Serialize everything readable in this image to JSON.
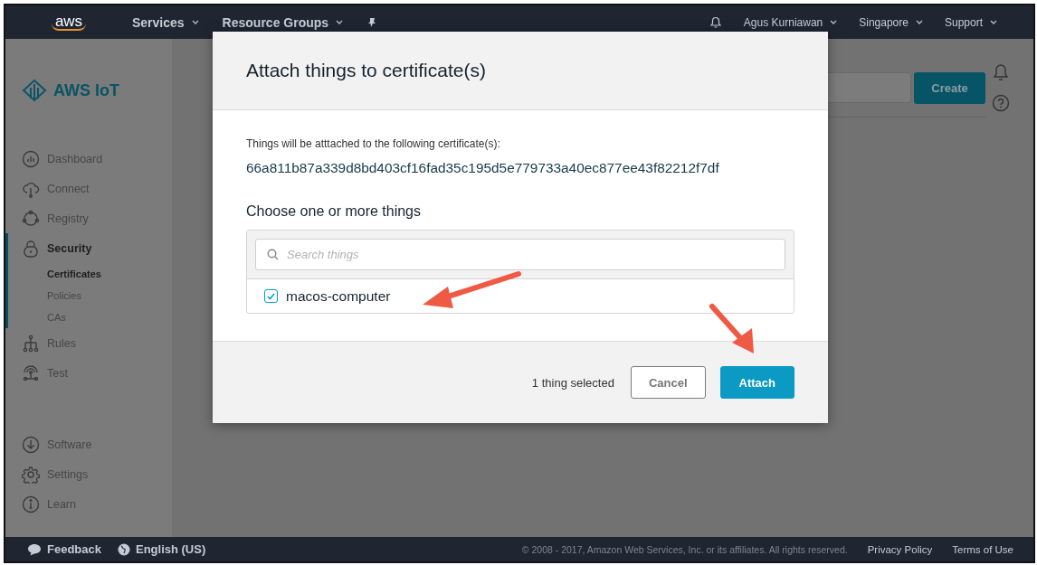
{
  "top_nav": {
    "logo": "aws",
    "menus": [
      {
        "label": "Services"
      },
      {
        "label": "Resource Groups"
      }
    ],
    "user": "Agus Kurniawan",
    "region": "Singapore",
    "support": "Support"
  },
  "sidebar": {
    "title": "AWS IoT",
    "items": [
      {
        "label": "Dashboard",
        "selected": false
      },
      {
        "label": "Connect",
        "selected": false
      },
      {
        "label": "Registry",
        "selected": false
      },
      {
        "label": "Security",
        "selected": true,
        "children": [
          {
            "label": "Certificates",
            "selected": true
          },
          {
            "label": "Policies",
            "selected": false
          },
          {
            "label": "CAs",
            "selected": false
          }
        ]
      },
      {
        "label": "Rules",
        "selected": false
      },
      {
        "label": "Test",
        "selected": false
      }
    ],
    "bottom_items": [
      {
        "label": "Software",
        "selected": false
      },
      {
        "label": "Settings",
        "selected": false
      },
      {
        "label": "Learn",
        "selected": false
      }
    ]
  },
  "content": {
    "create_button": "Create"
  },
  "dialog": {
    "title": "Attach things to certificate(s)",
    "message": "Things will be atttached to the following certificate(s):",
    "certificate_id": "66a811b87a339d8bd403cf16fad35c195d5e779733a40ec877ee43f82212f7df",
    "choose_label": "Choose one or more things",
    "search": {
      "placeholder": "Search things"
    },
    "things": [
      {
        "label": "macos-computer",
        "checked": true
      }
    ],
    "selection_count": "1 thing selected",
    "buttons": [
      {
        "label": "Cancel",
        "kind": "secondary"
      },
      {
        "label": "Attach",
        "kind": "primary"
      }
    ]
  },
  "footer": {
    "feedback": "Feedback",
    "language": "English (US)",
    "copyright": "© 2008 - 2017, Amazon Web Services, Inc. or its affiliates. All rights reserved.",
    "links": [
      "Privacy Policy",
      "Terms of Use"
    ]
  }
}
